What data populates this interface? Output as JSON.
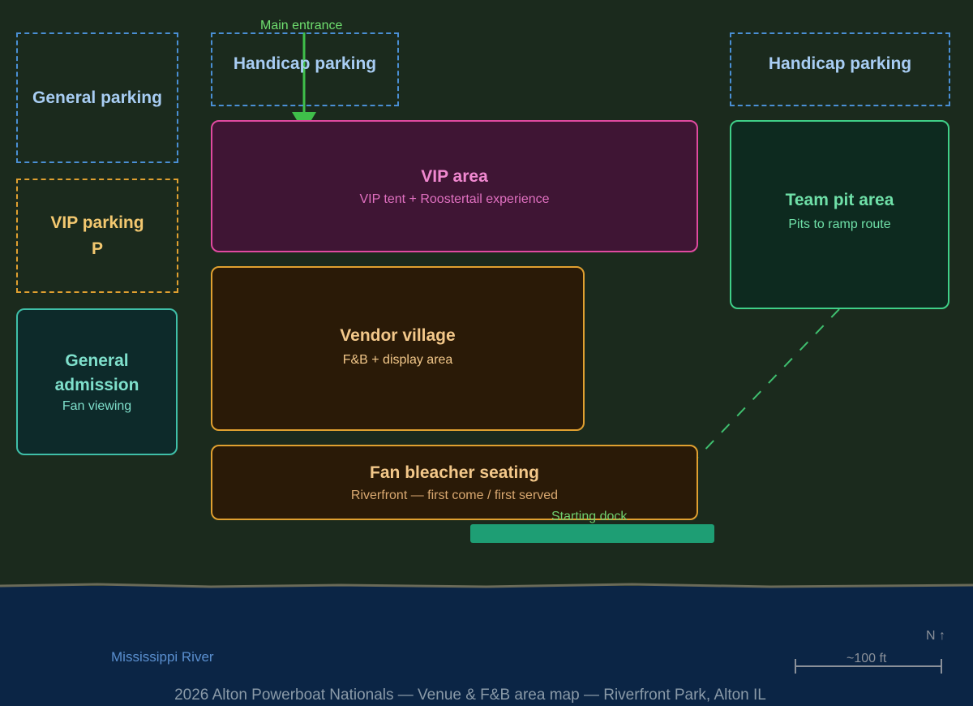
{
  "map_title": "2026 Alton Powerboat Nationals — Venue & F&B area map — Riverfront Park, Alton IL",
  "colors": {
    "land": "#1b2a1d",
    "river": "#0b2545",
    "parking_blue": "#4a8fd4",
    "parking_text": "#a8cdf3",
    "vip_parking": "#e0a030",
    "vip_parking_text": "#f3c870",
    "ga": "#3fbfa8",
    "ga_text": "#7fe0cc",
    "vip": "#e04aa0",
    "vip_text": "#f088d0",
    "vendor": "#e0a030",
    "vendor_text": "#f3c88a",
    "pit": "#3fcf88",
    "pit_text": "#6fe0a8",
    "route": "#3fbf6f",
    "dock": "#1e9e74"
  },
  "zones": {
    "general_parking": {
      "title": "General parking"
    },
    "handicap_parking_left": {
      "title": "Handicap parking"
    },
    "handicap_parking_right": {
      "title": "Handicap parking"
    },
    "vip_parking": {
      "title": "VIP parking",
      "symbol": "P"
    },
    "general_admission": {
      "title": "General admission",
      "subtitle": "Fan viewing"
    },
    "vip_area": {
      "title": "VIP area",
      "subtitle": "VIP tent + Roostertail experience"
    },
    "team_pit_area": {
      "title": "Team pit area",
      "subtitle": "Pits to ramp route"
    },
    "vendor_village": {
      "title": "Vendor village",
      "subtitle": "F&B + display area"
    },
    "fan_bleacher_seating": {
      "title": "Fan bleacher seating",
      "subtitle": "Riverfront — first come / first served"
    }
  },
  "labels": {
    "main_entrance": "Main entrance",
    "starting_dock": "Starting dock",
    "river": "Mississippi River",
    "north": "N ↑",
    "scale": "~100 ft"
  }
}
